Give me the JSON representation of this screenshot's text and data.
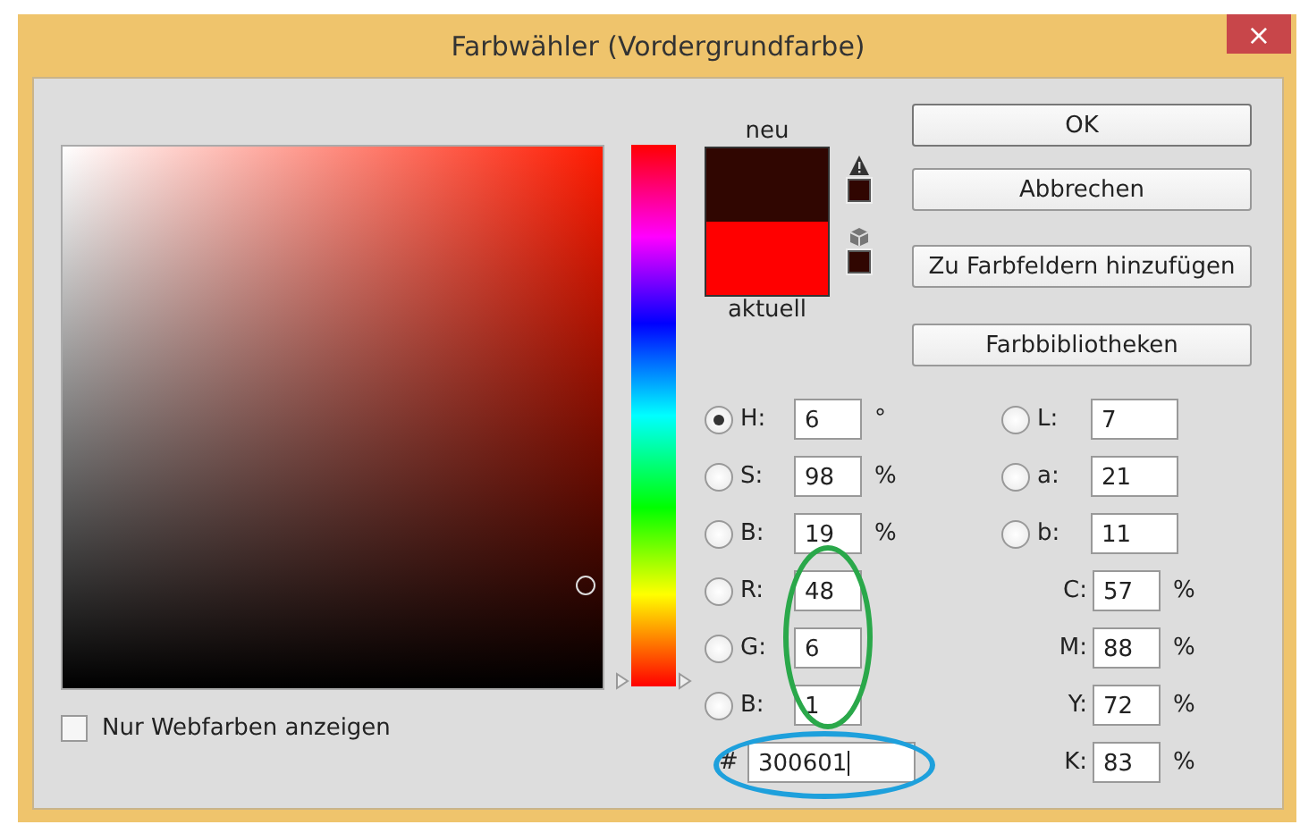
{
  "window": {
    "title": "Farbwähler (Vordergrundfarbe)",
    "close": "×"
  },
  "hue_slider": {
    "level": 0.017
  },
  "swatches": [
    {
      "label": "neu",
      "color": "#300601"
    },
    {
      "label": "aktuell",
      "color": "#ff0000"
    }
  ],
  "buttons": [
    {
      "label": "OK",
      "default": true
    },
    {
      "label": "Abbrechen",
      "default": false
    },
    {
      "label": "Zu Farbfeldern hinzufügen",
      "default": false
    },
    {
      "label": "Farbbibliotheken",
      "default": false
    }
  ],
  "web_colors_only": {
    "label": "Nur Webfarben anzeigen",
    "checked": false
  },
  "left_fields": [
    {
      "label": "H:",
      "value": "6",
      "unit": "°",
      "selected": true
    },
    {
      "label": "S:",
      "value": "98",
      "unit": "%",
      "selected": false
    },
    {
      "label": "B:",
      "value": "19",
      "unit": "%",
      "selected": false
    },
    {
      "label": "R:",
      "value": "48",
      "selected": false
    },
    {
      "label": "G:",
      "value": "6",
      "selected": false
    },
    {
      "label": "B:",
      "value": "1",
      "selected": false
    }
  ],
  "lab_fields": [
    {
      "label": "L:",
      "value": "7",
      "selected": false
    },
    {
      "label": "a:",
      "value": "21",
      "selected": false
    },
    {
      "label": "b:",
      "value": "11",
      "selected": false
    }
  ],
  "cmyk_fields": [
    {
      "label": "C:",
      "value": "57",
      "unit": "%"
    },
    {
      "label": "M:",
      "value": "88",
      "unit": "%"
    },
    {
      "label": "Y:",
      "value": "72",
      "unit": "%"
    },
    {
      "label": "K:",
      "value": "83",
      "unit": "%"
    }
  ],
  "hex": {
    "label": "#",
    "value": "300601"
  },
  "annotations": [
    {
      "color": "#2aa84a"
    },
    {
      "color": "#1ea0dc"
    }
  ]
}
